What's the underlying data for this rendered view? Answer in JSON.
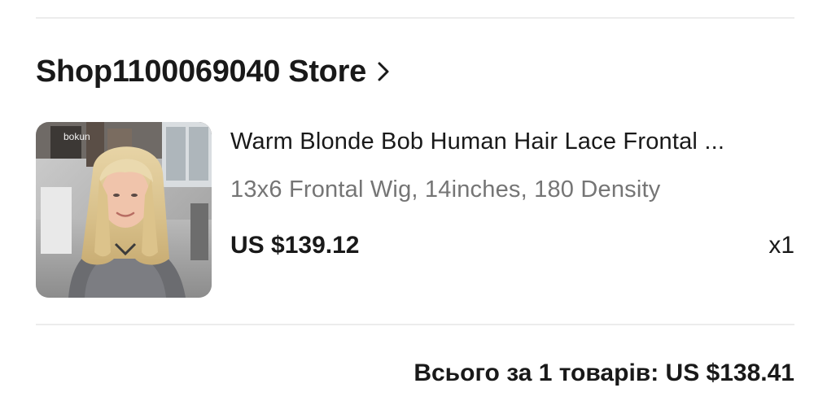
{
  "store": {
    "name": "Shop1100069040 Store",
    "chevron_icon": "chevron-right-icon"
  },
  "product": {
    "thumbnail_icon": "product-photo",
    "watermark": "bokun",
    "title": "Warm Blonde Bob Human Hair Lace Frontal ...",
    "variant": "13x6 Frontal Wig, 14inches, 180 Density",
    "price": "US $139.12",
    "quantity": "x1"
  },
  "summary": {
    "total": "Всього за 1 товарів: US $138.41"
  },
  "colors": {
    "text_primary": "#191919",
    "text_secondary": "#757575",
    "divider": "#ececec",
    "background": "#ffffff"
  }
}
